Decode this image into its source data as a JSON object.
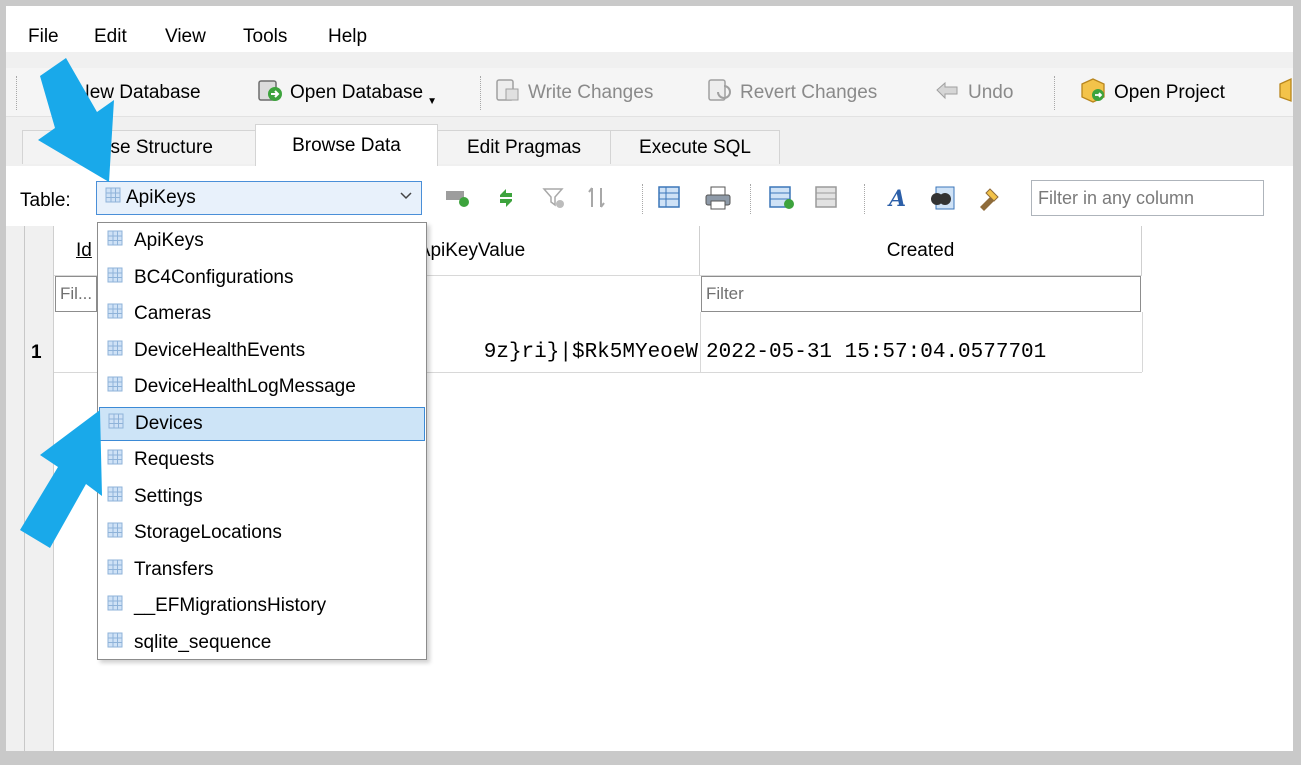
{
  "menubar": {
    "items": [
      "File",
      "Edit",
      "View",
      "Tools",
      "Help"
    ]
  },
  "toolbar": {
    "new_database": "New Database",
    "open_database": "Open Database",
    "write_changes": "Write Changes",
    "revert_changes": "Revert Changes",
    "undo": "Undo",
    "open_project": "Open Project"
  },
  "tabs": [
    {
      "label": "Database Structure",
      "visible_label": "D      se Structure"
    },
    {
      "label": "Browse Data"
    },
    {
      "label": "Edit Pragmas"
    },
    {
      "label": "Execute SQL"
    }
  ],
  "table_selector": {
    "label": "Table:",
    "value": "ApiKeys"
  },
  "filter_any": {
    "placeholder": "Filter in any column"
  },
  "grid": {
    "columns": [
      "Id",
      "ApiKeyValue",
      "Created"
    ],
    "column_visible": [
      "Id",
      "ApiKeyValue",
      "Created"
    ],
    "filter_placeholders": [
      "Fil...",
      "",
      "Filter"
    ],
    "rows": [
      {
        "row_number": "1",
        "apikeyvalue_visible": "9z}ri}|$Rk5MYeoeW",
        "created": "2022-05-31 15:57:04.0577701"
      }
    ]
  },
  "dropdown": {
    "items": [
      "ApiKeys",
      "BC4Configurations",
      "Cameras",
      "DeviceHealthEvents",
      "DeviceHealthLogMessage",
      "Devices",
      "Requests",
      "Settings",
      "StorageLocations",
      "Transfers",
      "__EFMigrationsHistory",
      "sqlite_sequence"
    ],
    "selected": "Devices"
  },
  "colors": {
    "arrow": "#19a9ea",
    "selection_fill": "#cde4f7",
    "selection_border": "#3b8ad6"
  }
}
